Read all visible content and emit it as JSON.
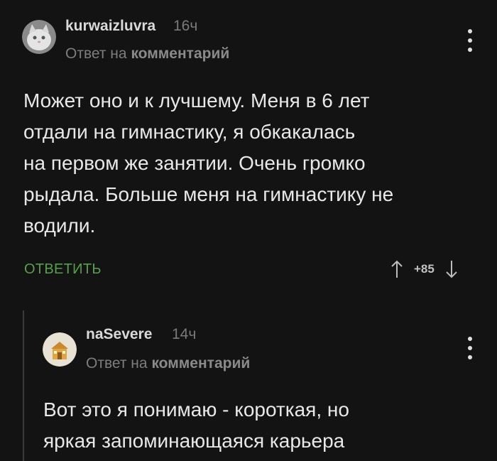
{
  "comment1": {
    "author": "kurwaizluvra",
    "time": "16ч",
    "reply_prefix": "Ответ на",
    "reply_target": "комментарий",
    "body_lines": [
      "Может оно и к лучшему. Меня в 6 лет",
      "отдали на гимнастику, я обкакалась",
      "на первом же занятии. Очень громко",
      "рыдала. Больше меня на гимнастику не",
      "водили."
    ],
    "reply_button": "ОТВЕТИТЬ",
    "score": "+85",
    "menu_icon": "kebab-menu-icon"
  },
  "comment2": {
    "author": "naSevere",
    "time": "14ч",
    "reply_prefix": "Ответ на",
    "reply_target": "комментарий",
    "body_lines": [
      "Вот это я понимаю - короткая, но",
      "яркая запоминающаяся карьера"
    ],
    "menu_icon": "kebab-menu-icon"
  },
  "colors": {
    "background": "#131313",
    "accent_green": "#55a14a",
    "muted": "#7a7a7a"
  }
}
